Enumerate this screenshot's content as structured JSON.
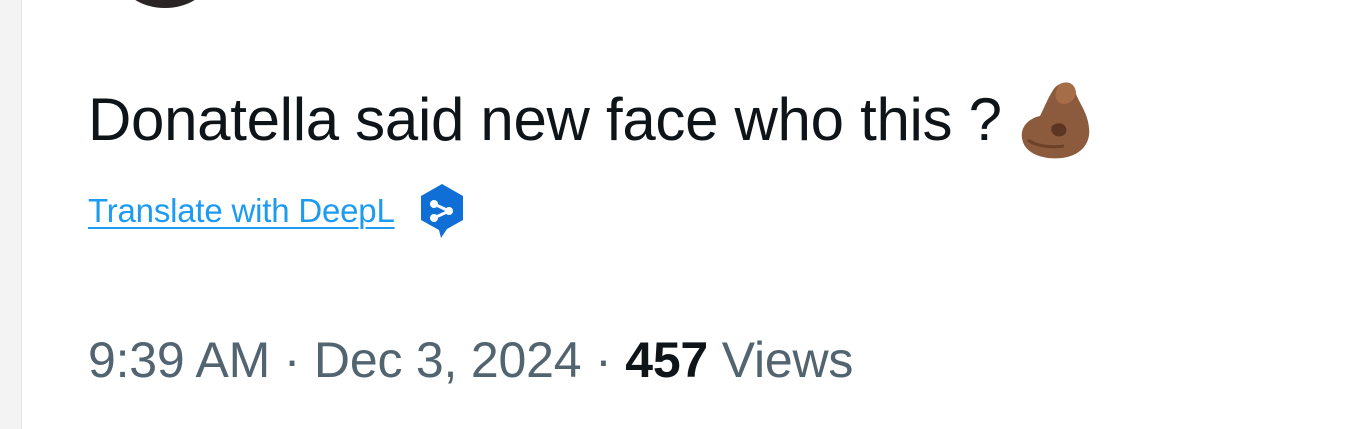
{
  "tweet": {
    "text": "Donatella said new face who this ?",
    "emoji": "pinched-fingers-medium-dark-skin",
    "translate_label": "Translate with DeepL",
    "time": "9:39 AM",
    "separator": "·",
    "date": "Dec 3, 2024",
    "views_count": "457",
    "views_label": "Views"
  },
  "colors": {
    "text": "#0f1419",
    "secondary": "#536471",
    "link": "#1d9bf0",
    "deepl": "#0f6fd6"
  }
}
